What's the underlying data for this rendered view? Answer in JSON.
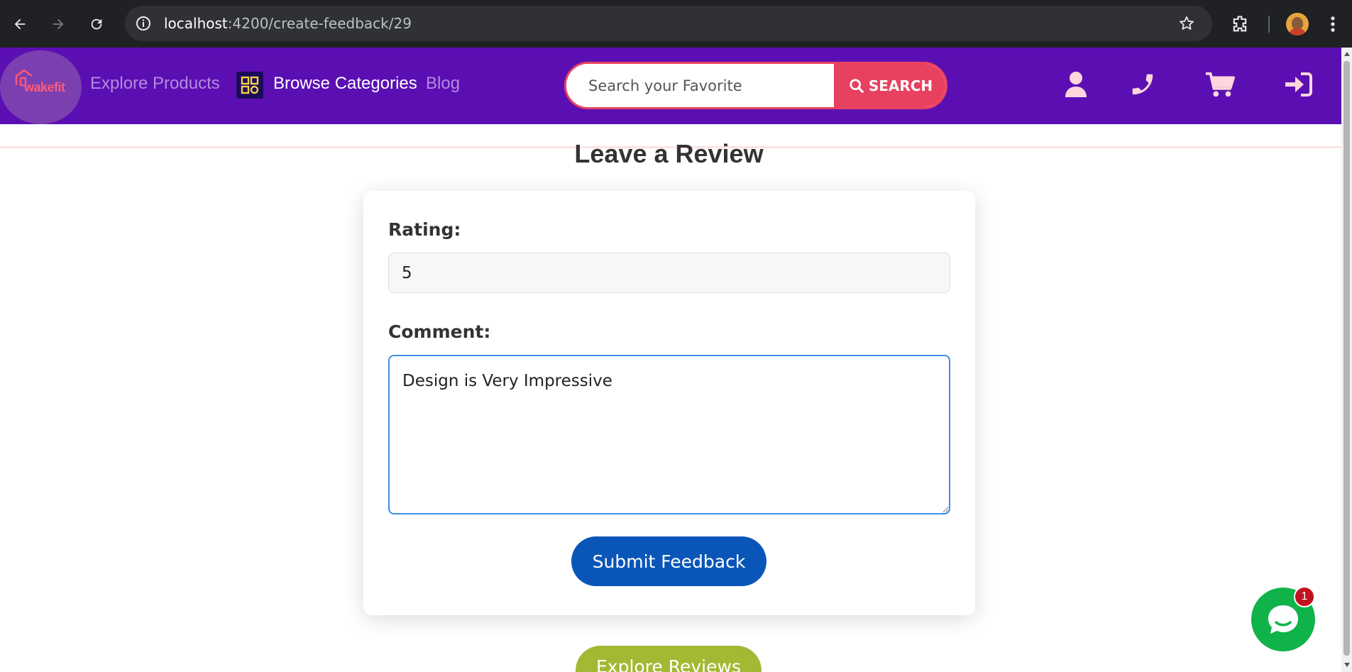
{
  "browser": {
    "url_host": "localhost",
    "url_path": ":4200/create-feedback/29"
  },
  "header": {
    "logo_text": "wakefit",
    "nav": {
      "explore": "Explore Products",
      "browse": "Browse Categories",
      "blog": "Blog"
    },
    "search": {
      "placeholder": "Search your Favorite",
      "button_label": "SEARCH"
    },
    "icons": [
      "user-icon",
      "phone-icon",
      "cart-icon",
      "sign-in-icon"
    ],
    "colors": {
      "bar": "#5b0fb3",
      "accent": "#e8415f",
      "icon": "#ffd6dc"
    }
  },
  "review": {
    "title": "Leave a Review",
    "rating_label": "Rating:",
    "rating_value": "5",
    "comment_label": "Comment:",
    "comment_value": "Design is Very Impressive ",
    "submit_label": "Submit Feedback",
    "explore_label": "Explore Reviews"
  },
  "chat": {
    "badge_count": "1"
  }
}
